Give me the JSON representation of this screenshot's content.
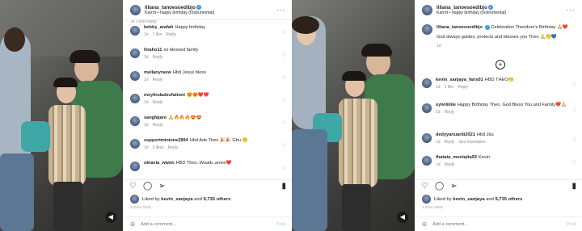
{
  "post": {
    "username": "liliana_tanoesoedibjo",
    "subtitle": "Karrot • happy birthday (Instrumental)"
  },
  "left_comments": [
    {
      "user": "",
      "text": "",
      "time": "1d",
      "likes": "",
      "reply": "Reply",
      "partial": "1d   1 like   Reply"
    },
    {
      "user": "bebby_arafah",
      "text": "Happy birthday",
      "time": "1d",
      "likes": "1 like",
      "reply": "Reply"
    },
    {
      "user": "linaho11",
      "text": "so blessed family",
      "time": "1d",
      "likes": "",
      "reply": "Reply"
    },
    {
      "user": "meilanyrauw",
      "text": "Hbd Jesus bless",
      "time": "1d",
      "likes": "",
      "reply": "Reply"
    },
    {
      "user": "meylindadesfattoni",
      "text": "😍😍❤️❤️",
      "time": "1d",
      "likes": "",
      "reply": "Reply"
    },
    {
      "user": "sangfajare",
      "text": "🙏🔥🔥🔥😍😍",
      "time": "1d",
      "likes": "",
      "reply": "Reply"
    },
    {
      "user": "supportminions2894",
      "text": "Hbd Ade Theo 🎉🎉 Gbu 🤭",
      "time": "1d",
      "likes": "2 likes",
      "reply": "Reply"
    },
    {
      "user": "oktavia_wiwin",
      "text": "HBD Theo..Wuatb..amen❤️",
      "time": "",
      "likes": "",
      "reply": ""
    }
  ],
  "caption": {
    "user": "liliana_tanoesoedibjo",
    "text": "Celebration Theodore's Birthday 🙏❤️",
    "text2": "God always guides, protects and blesses you Theo 🙏🤭💙",
    "time": "1d"
  },
  "right_comments": [
    {
      "user": "kevin_sanjaya_fans01",
      "text": "HBD THEO🤭",
      "time": "1d",
      "likes": "1 like",
      "reply": "Reply"
    },
    {
      "user": "sylviiiiiiie",
      "text": "Happy Birthday Theo, God Bless You and Family❤️🙏",
      "time": "1d",
      "likes": "",
      "reply": "Reply"
    },
    {
      "user": "dedyyanuardi2021",
      "text": "Hbd Jbu",
      "time": "1d",
      "likes": "",
      "reply": "Reply",
      "extra": "See translation"
    },
    {
      "user": "thatata_moniqita93",
      "text": "Kevin",
      "time": "1d",
      "likes": "",
      "reply": "Reply"
    }
  ],
  "actions": {
    "liked_prefix": "Liked by",
    "liked_user": "kevin_sanjaya",
    "liked_and": "and",
    "liked_others": "9,735 others",
    "ago": "1 DAY AGO",
    "comment_placeholder": "Add a comment...",
    "post_label": "Post"
  },
  "colors": {
    "link": "#3897f0",
    "post_disabled": "#b2dffc",
    "muted": "#8e8e8e"
  }
}
